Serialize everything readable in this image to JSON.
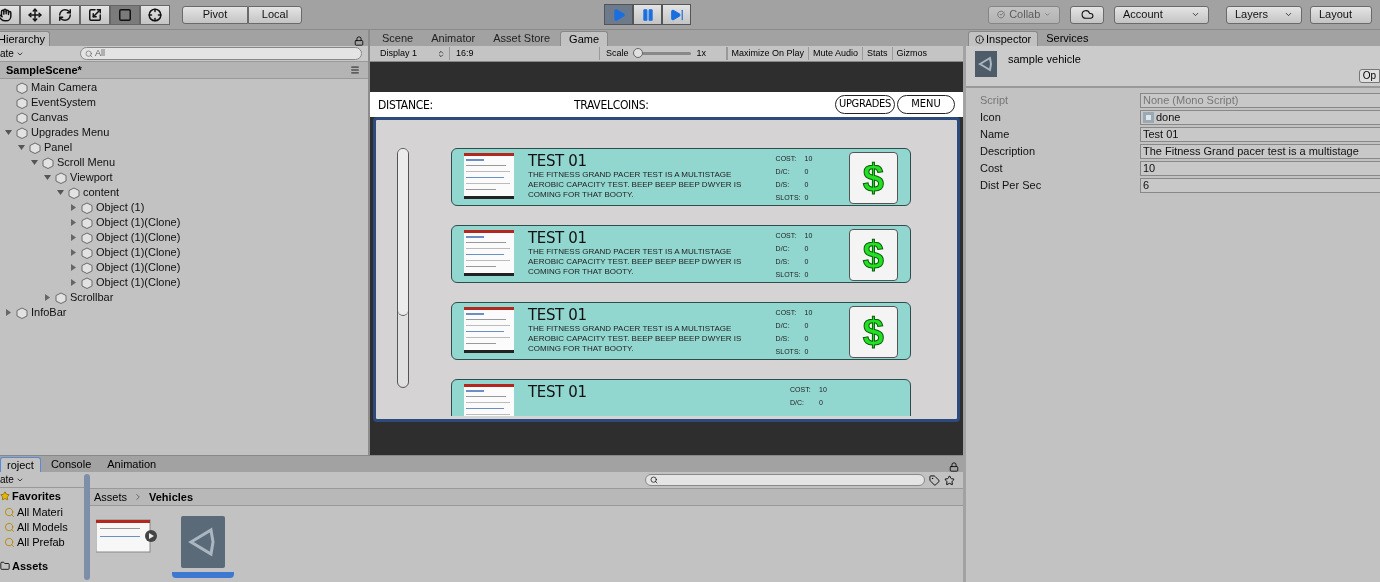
{
  "toolbar": {
    "tools": [
      {
        "kind": "hand",
        "selected": false
      },
      {
        "kind": "move",
        "selected": false
      },
      {
        "kind": "rotate",
        "selected": false
      },
      {
        "kind": "scale",
        "selected": false
      },
      {
        "kind": "rect",
        "selected": true
      },
      {
        "kind": "transform",
        "selected": false
      }
    ],
    "pivot": "Pivot",
    "local": "Local",
    "playback": [
      {
        "kind": "play",
        "selected": true
      },
      {
        "kind": "pause",
        "selected": false
      },
      {
        "kind": "step",
        "selected": false
      }
    ],
    "collab": {
      "label": "Collab",
      "disabled": true
    },
    "account": "Account",
    "layers": "Layers",
    "layout": "Layout"
  },
  "hierarchy": {
    "tab": "Hierarchy",
    "create": "ate",
    "search_placeholder": "All",
    "scene": "SampleScene*",
    "items": [
      {
        "label": "Main Camera"
      },
      {
        "label": "EventSystem"
      },
      {
        "label": "Canvas"
      },
      {
        "label": "Upgrades Menu",
        "expanded": true,
        "children": [
          {
            "label": "Panel",
            "expanded": true,
            "children": [
              {
                "label": "Scroll Menu",
                "expanded": true,
                "children": [
                  {
                    "label": "Viewport",
                    "expanded": true,
                    "children": [
                      {
                        "label": "content",
                        "expanded": true,
                        "children": [
                          {
                            "label": "Object (1)",
                            "expanded": false
                          },
                          {
                            "label": "Object (1)(Clone)",
                            "expanded": false
                          },
                          {
                            "label": "Object (1)(Clone)",
                            "expanded": false
                          },
                          {
                            "label": "Object (1)(Clone)",
                            "expanded": false
                          },
                          {
                            "label": "Object (1)(Clone)",
                            "expanded": false
                          },
                          {
                            "label": "Object (1)(Clone)",
                            "expanded": false
                          }
                        ]
                      }
                    ]
                  },
                  {
                    "label": "Scrollbar",
                    "expanded": false
                  }
                ]
              }
            ]
          }
        ]
      },
      {
        "label": "InfoBar",
        "expanded": false
      }
    ]
  },
  "center_tabs": [
    {
      "label": "Scene",
      "selected": false
    },
    {
      "label": "Animator",
      "selected": false
    },
    {
      "label": "Asset Store",
      "selected": false
    },
    {
      "label": "Game",
      "selected": true
    }
  ],
  "game_toolbar": {
    "display": "Display 1",
    "aspect": "16:9",
    "scale_label": "Scale",
    "scale": {
      "level": 0
    },
    "scale_value": "1x",
    "buttons": [
      "Maximize On Play",
      "Mute Audio",
      "Stats",
      "Gizmos"
    ]
  },
  "game": {
    "distance": "DISTANCE:",
    "coins": "TRAVELCOINS:",
    "upgrades": "UPGRADES",
    "menu": "MENU",
    "scroll": {
      "level": 0.7
    },
    "cards": [
      {
        "title": "TEST 01",
        "description": "THE FITNESS GRAND PACER TEST IS A MULTISTAGE AEROBIC CAPACITY TEST. BEEP BEEP BEEP DWYER IS COMING FOR THAT BOOTY.",
        "stats": [
          {
            "label": "COST:",
            "value": "10"
          },
          {
            "label": "D/C:",
            "value": "0"
          },
          {
            "label": "D/S:",
            "value": "0"
          },
          {
            "label": "SLOTS:",
            "value": "0"
          }
        ],
        "buy": "$"
      },
      {
        "title": "TEST 01",
        "description": "THE FITNESS GRAND PACER TEST IS A MULTISTAGE AEROBIC CAPACITY TEST. BEEP BEEP BEEP DWYER IS COMING FOR THAT BOOTY.",
        "stats": [
          {
            "label": "COST:",
            "value": "10"
          },
          {
            "label": "D/C:",
            "value": "0"
          },
          {
            "label": "D/S:",
            "value": "0"
          },
          {
            "label": "SLOTS:",
            "value": "0"
          }
        ],
        "buy": "$"
      },
      {
        "title": "TEST 01",
        "description": "THE FITNESS GRAND PACER TEST IS A MULTISTAGE AEROBIC CAPACITY TEST. BEEP BEEP BEEP DWYER IS COMING FOR THAT BOOTY.",
        "stats": [
          {
            "label": "COST:",
            "value": "10"
          },
          {
            "label": "D/C:",
            "value": "0"
          },
          {
            "label": "D/S:",
            "value": "0"
          },
          {
            "label": "SLOTS:",
            "value": "0"
          }
        ],
        "buy": "$"
      },
      {
        "title": "TEST 01",
        "stats": [
          {
            "label": "COST:",
            "value": "10"
          },
          {
            "label": "D/C:",
            "value": "0"
          }
        ]
      }
    ]
  },
  "inspector": {
    "tabs": [
      {
        "label": "Inspector",
        "selected": true
      },
      {
        "label": "Services",
        "selected": false
      }
    ],
    "object": "sample vehicle",
    "open": "Op",
    "fields": [
      {
        "label": "Script",
        "value": "None (Mono Script)",
        "disabled": true
      },
      {
        "label": "Icon",
        "value": "done",
        "kind": "asset"
      },
      {
        "label": "Name",
        "value": "Test 01"
      },
      {
        "label": "Description",
        "value": "The Fitness Grand pacer test is a multistage"
      },
      {
        "label": "Cost",
        "value": "10"
      },
      {
        "label": "Dist Per Sec",
        "value": "6"
      }
    ]
  },
  "project": {
    "tabs": [
      {
        "label": "roject",
        "selected": true
      },
      {
        "label": "Console",
        "selected": false
      },
      {
        "label": "Animation",
        "selected": false
      }
    ],
    "create": "ate",
    "favorites": {
      "label": "Favorites",
      "items": [
        "All Materi",
        "All Models",
        "All Prefab"
      ]
    },
    "assets_label": "Assets",
    "breadcrumb": [
      "Assets",
      "Vehicles"
    ],
    "files": [
      {
        "kind": "video",
        "selected": false
      },
      {
        "kind": "unity",
        "selected": true
      }
    ]
  }
}
